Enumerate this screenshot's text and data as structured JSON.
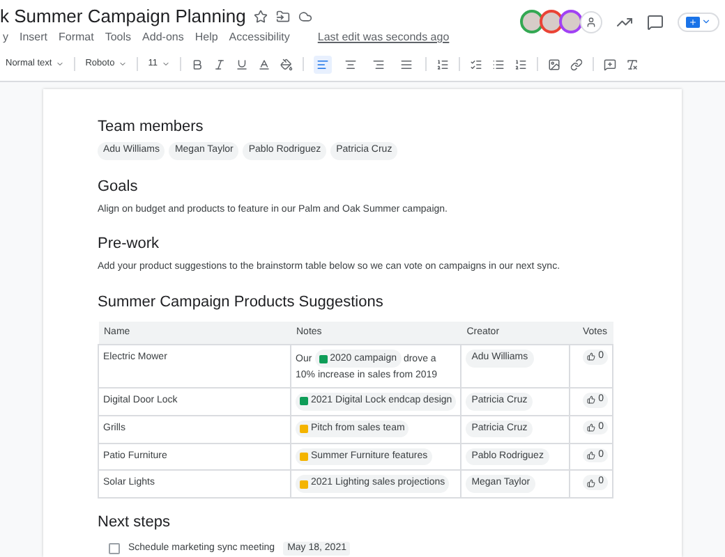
{
  "document": {
    "title": "k Summer Campaign Planning",
    "last_edit": "Last edit was seconds ago"
  },
  "menu": [
    "y",
    "Insert",
    "Format",
    "Tools",
    "Add-ons",
    "Help",
    "Accessibility"
  ],
  "toolbar": {
    "style": "Normal text",
    "font": "Roboto",
    "size": "11",
    "alignment": [
      {
        "kind": "left",
        "selected": true
      },
      {
        "kind": "center",
        "selected": false
      },
      {
        "kind": "right",
        "selected": false
      },
      {
        "kind": "justify",
        "selected": false
      }
    ]
  },
  "collaborators": [
    {
      "color": "#34a853"
    },
    {
      "color": "#ea4335"
    },
    {
      "color": "#a142f4"
    }
  ],
  "sections": [
    {
      "heading": "Team members",
      "chips": [
        "Adu Williams",
        "Megan Taylor",
        "Pablo Rodriguez",
        "Patricia Cruz"
      ]
    },
    {
      "heading": "Goals",
      "text": "Align on budget and products to feature in our Palm and Oak Summer campaign."
    },
    {
      "heading": "Pre-work",
      "text": "Add your product suggestions to the brainstorm table below so we can vote on campaigns in our next sync."
    },
    {
      "heading": "Summer Campaign Products Suggestions"
    }
  ],
  "table": {
    "columns": [
      "Name",
      "Notes",
      "Creator",
      "Votes"
    ],
    "rows": [
      {
        "name": "Electric Mower",
        "notes": {
          "prefix": "Our",
          "chip": {
            "kind": "sheet",
            "label": "2020 campaign"
          },
          "suffix": "drove a 10% increase in sales from 2019"
        },
        "creator": "Adu Williams",
        "votes": "0"
      },
      {
        "name": "Digital Door Lock",
        "notes": {
          "chip": {
            "kind": "sheet",
            "label": "2021 Digital Lock endcap design"
          }
        },
        "creator": "Patricia Cruz",
        "votes": "0"
      },
      {
        "name": "Grills",
        "notes": {
          "chip": {
            "kind": "slides",
            "label": "Pitch from sales team"
          }
        },
        "creator": "Patricia Cruz",
        "votes": "0"
      },
      {
        "name": "Patio Furniture",
        "notes": {
          "chip": {
            "kind": "slides",
            "label": "Summer Furniture features"
          }
        },
        "creator": "Pablo Rodriguez",
        "votes": "0"
      },
      {
        "name": "Solar Lights",
        "notes": {
          "chip": {
            "kind": "slides",
            "label": "2021 Lighting sales projections"
          }
        },
        "creator": "Megan Taylor",
        "votes": "0"
      }
    ]
  },
  "next_steps": {
    "heading": "Next steps",
    "items": [
      {
        "text": "Schedule marketing sync meeting",
        "date": "May 18, 2021",
        "checked": false
      }
    ]
  }
}
